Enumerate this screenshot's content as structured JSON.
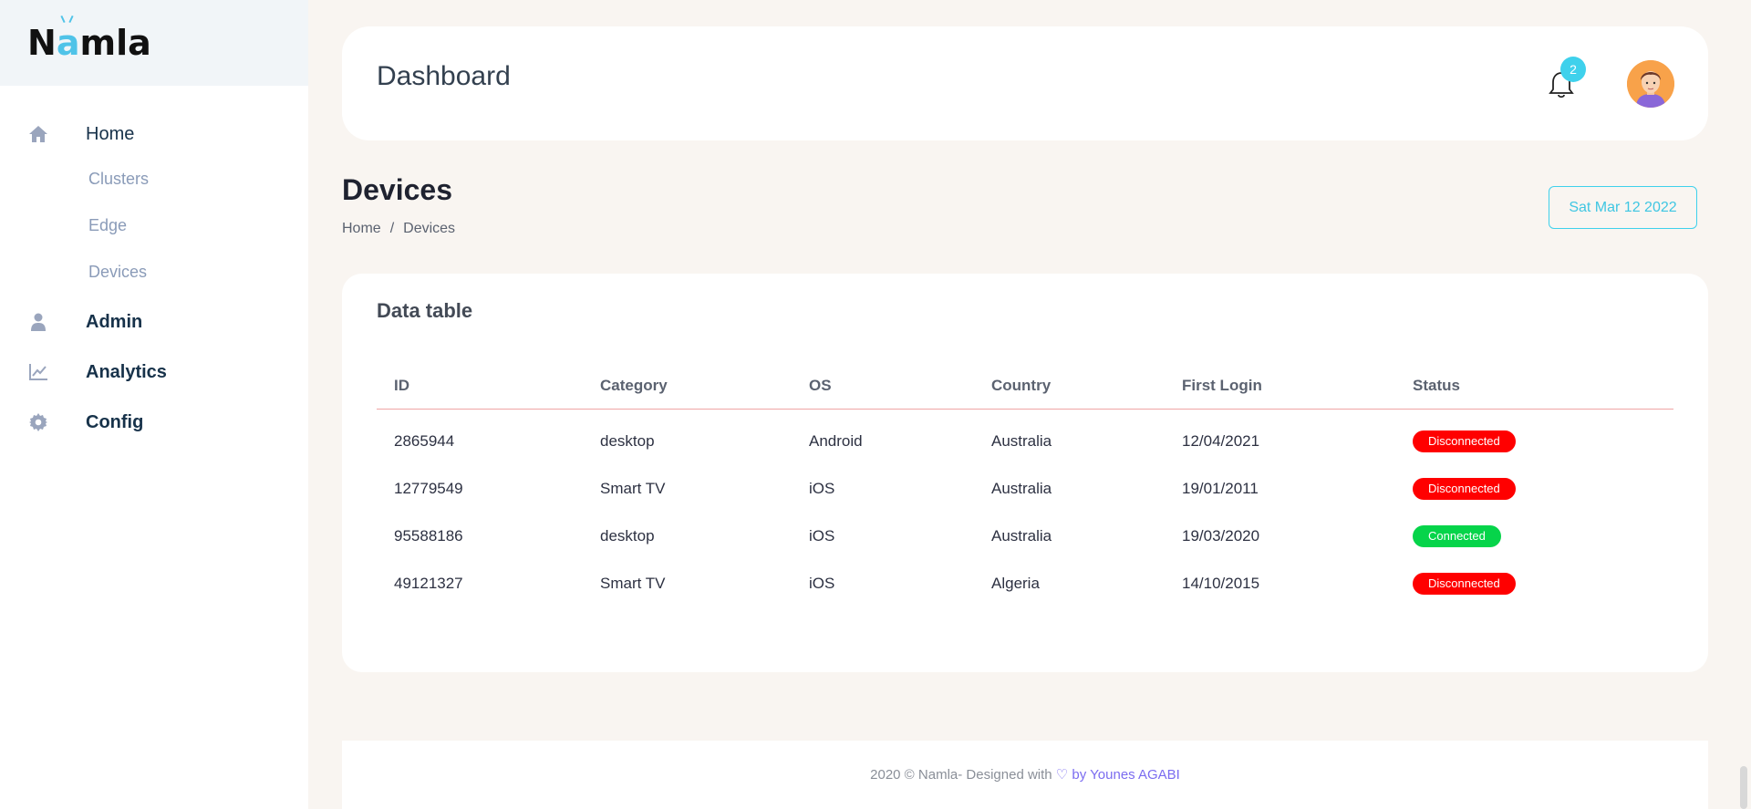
{
  "brand": {
    "logo_text_1": "N",
    "logo_text_2": "a",
    "logo_text_3": "mla",
    "accent_color": "#4fc3e8"
  },
  "sidebar": {
    "items": [
      {
        "label": "Home",
        "icon": "home-icon"
      },
      {
        "label": "Admin",
        "icon": "user-icon"
      },
      {
        "label": "Analytics",
        "icon": "chart-line-icon"
      },
      {
        "label": "Config",
        "icon": "gear-icon"
      }
    ],
    "home_sub": [
      "Clusters",
      "Edge",
      "Devices"
    ]
  },
  "header": {
    "title": "Dashboard",
    "notification_count": "2",
    "icons": [
      "bell-icon",
      "avatar"
    ]
  },
  "page": {
    "title": "Devices",
    "breadcrumb": [
      "Home",
      "/",
      "Devices"
    ],
    "date": "Sat Mar 12 2022"
  },
  "card": {
    "title": "Data table",
    "columns": [
      "ID",
      "Category",
      "OS",
      "Country",
      "First Login",
      "Status"
    ],
    "rows": [
      {
        "id": "2865944",
        "category": "desktop",
        "os": "Android",
        "country": "Australia",
        "first_login": "12/04/2021",
        "status": "Disconnected"
      },
      {
        "id": "12779549",
        "category": "Smart TV",
        "os": "iOS",
        "country": "Australia",
        "first_login": "19/01/2011",
        "status": "Disconnected"
      },
      {
        "id": "95588186",
        "category": "desktop",
        "os": "iOS",
        "country": "Australia",
        "first_login": "19/03/2020",
        "status": "Connected"
      },
      {
        "id": "49121327",
        "category": "Smart TV",
        "os": "iOS",
        "country": "Algeria",
        "first_login": "14/10/2015",
        "status": "Disconnected"
      }
    ]
  },
  "status_colors": {
    "Disconnected": "#ff0000",
    "Connected": "#06d44a"
  },
  "footer": {
    "prefix": "2020 © Namla- Designed with",
    "heart": "♡",
    "author": "by Younes AGABI"
  }
}
